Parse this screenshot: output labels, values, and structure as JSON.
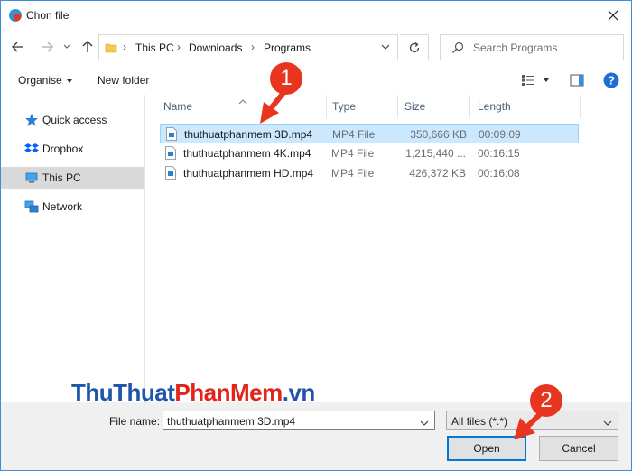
{
  "window": {
    "title": "Chon file"
  },
  "address": {
    "crumbs": [
      "This PC",
      "Downloads",
      "Programs"
    ]
  },
  "search": {
    "placeholder": "Search Programs"
  },
  "toolbar": {
    "organise_label": "Organise",
    "new_folder_label": "New folder"
  },
  "sidebar": {
    "items": [
      {
        "label": "Quick access",
        "icon": "star-icon"
      },
      {
        "label": "Dropbox",
        "icon": "dropbox-icon"
      },
      {
        "label": "This PC",
        "icon": "computer-icon",
        "selected": true
      },
      {
        "label": "Network",
        "icon": "network-icon"
      }
    ]
  },
  "filelist": {
    "columns": {
      "name": "Name",
      "type": "Type",
      "size": "Size",
      "length": "Length"
    },
    "rows": [
      {
        "name": "thuthuatphanmem 3D.mp4",
        "type": "MP4 File",
        "size": "350,666 KB",
        "length": "00:09:09",
        "selected": true
      },
      {
        "name": "thuthuatphanmem 4K.mp4",
        "type": "MP4 File",
        "size": "1,215,440 ...",
        "length": "00:16:15",
        "selected": false
      },
      {
        "name": "thuthuatphanmem HD.mp4",
        "type": "MP4 File",
        "size": "426,372 KB",
        "length": "00:16:08",
        "selected": false
      }
    ]
  },
  "watermark": {
    "part1": "ThuThuat",
    "part2": "PhanMem",
    "part3": ".vn"
  },
  "footer": {
    "filename_label": "File name:",
    "filename_value": "thuthuatphanmem 3D.mp4",
    "filetype_value": "All files (*.*)",
    "open_label": "Open",
    "cancel_label": "Cancel"
  },
  "annotations": {
    "step1": "1",
    "step2": "2"
  },
  "colors": {
    "accent": "#0078d7",
    "selection": "#cce8ff",
    "annotation_red": "#e8351f",
    "watermark_blue": "#1f56a8",
    "watermark_red": "#e1251b"
  }
}
